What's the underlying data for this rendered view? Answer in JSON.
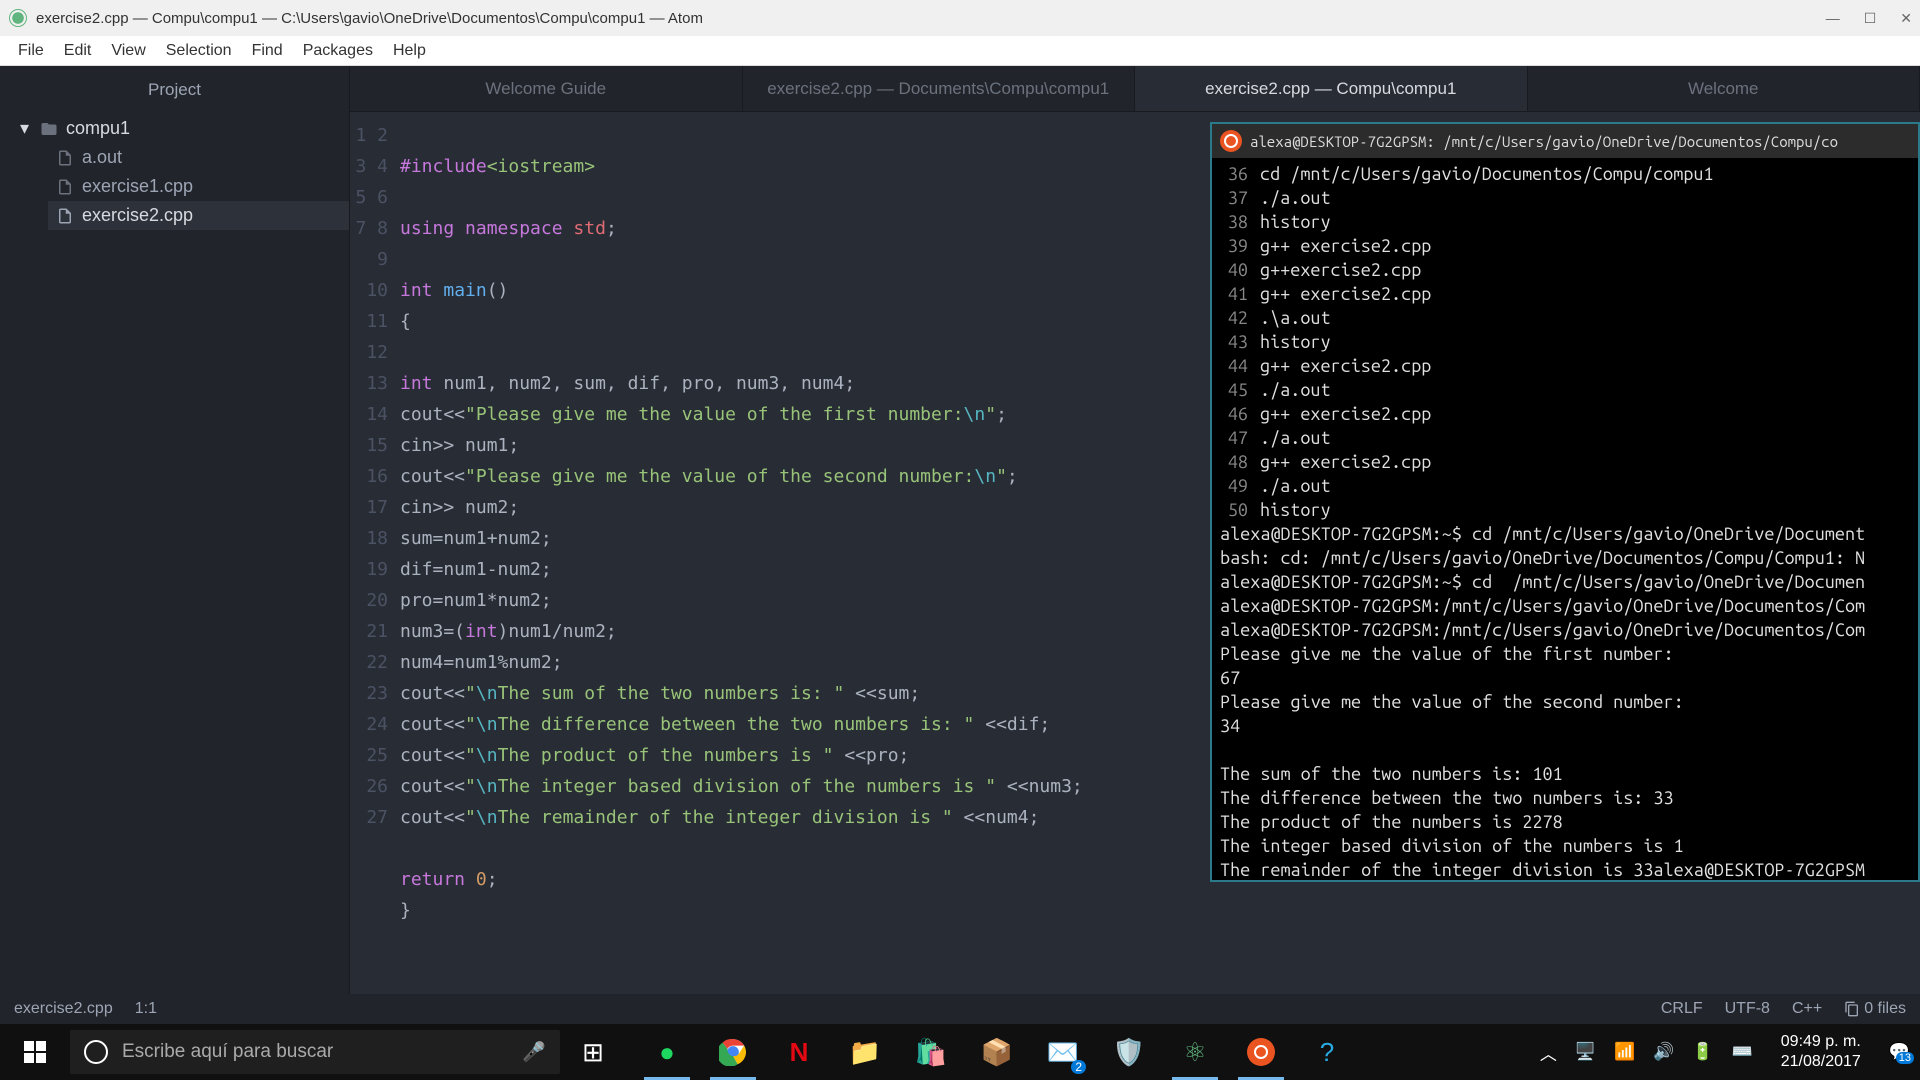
{
  "window": {
    "title": "exercise2.cpp — Compu\\compu1 — C:\\Users\\gavio\\OneDrive\\Documentos\\Compu\\compu1 — Atom"
  },
  "menu": [
    "File",
    "Edit",
    "View",
    "Selection",
    "Find",
    "Packages",
    "Help"
  ],
  "sidebar": {
    "header": "Project",
    "root": "compu1",
    "files": [
      "a.out",
      "exercise1.cpp",
      "exercise2.cpp"
    ]
  },
  "tabs": [
    {
      "label": "Welcome Guide",
      "active": false
    },
    {
      "label": "exercise2.cpp — Documents\\Compu\\compu1",
      "active": false
    },
    {
      "label": "exercise2.cpp — Compu\\compu1",
      "active": true
    },
    {
      "label": "Welcome",
      "active": false
    }
  ],
  "code": {
    "line_count": 27,
    "lines": [
      "",
      "#include<iostream>",
      "",
      "using namespace std;",
      "",
      "int main()",
      "{",
      "",
      "int num1, num2, sum, dif, pro, num3, num4;",
      "cout<<\"Please give me the value of the first number:\\n\";",
      "cin>> num1;",
      "cout<<\"Please give me the value of the second number:\\n\";",
      "cin>> num2;",
      "sum=num1+num2;",
      "dif=num1-num2;",
      "pro=num1*num2;",
      "num3=(int)num1/num2;",
      "num4=num1%num2;",
      "cout<<\"\\nThe sum of the two numbers is: \" <<sum;",
      "cout<<\"\\nThe difference between the two numbers is: \" <<dif;",
      "cout<<\"\\nThe product of the numbers is \" <<pro;",
      "cout<<\"\\nThe integer based division of the numbers is \" <<num3;",
      "cout<<\"\\nThe remainder of the integer division is \" <<num4;",
      "",
      "return 0;",
      "}",
      ""
    ]
  },
  "terminal": {
    "title": "alexa@DESKTOP-7G2GPSM: /mnt/c/Users/gavio/OneDrive/Documentos/Compu/co",
    "history": [
      {
        "n": "36",
        "cmd": "cd /mnt/c/Users/gavio/Documentos/Compu/compu1"
      },
      {
        "n": "37",
        "cmd": "./a.out"
      },
      {
        "n": "38",
        "cmd": "history"
      },
      {
        "n": "39",
        "cmd": "g++ exercise2.cpp"
      },
      {
        "n": "40",
        "cmd": "g++exercise2.cpp"
      },
      {
        "n": "41",
        "cmd": "g++ exercise2.cpp"
      },
      {
        "n": "42",
        "cmd": ".\\a.out"
      },
      {
        "n": "43",
        "cmd": "history"
      },
      {
        "n": "44",
        "cmd": "g++ exercise2.cpp"
      },
      {
        "n": "45",
        "cmd": "./a.out"
      },
      {
        "n": "46",
        "cmd": "g++ exercise2.cpp"
      },
      {
        "n": "47",
        "cmd": "./a.out"
      },
      {
        "n": "48",
        "cmd": "g++ exercise2.cpp"
      },
      {
        "n": "49",
        "cmd": "./a.out"
      },
      {
        "n": "50",
        "cmd": "history"
      }
    ],
    "output": [
      "alexa@DESKTOP-7G2GPSM:~$ cd /mnt/c/Users/gavio/OneDrive/Document",
      "bash: cd: /mnt/c/Users/gavio/OneDrive/Documentos/Compu/Compu1: N",
      "alexa@DESKTOP-7G2GPSM:~$ cd  /mnt/c/Users/gavio/OneDrive/Documen",
      "alexa@DESKTOP-7G2GPSM:/mnt/c/Users/gavio/OneDrive/Documentos/Com",
      "alexa@DESKTOP-7G2GPSM:/mnt/c/Users/gavio/OneDrive/Documentos/Com",
      "Please give me the value of the first number:",
      "67",
      "Please give me the value of the second number:",
      "34",
      "",
      "The sum of the two numbers is: 101",
      "The difference between the two numbers is: 33",
      "The product of the numbers is 2278",
      "The integer based division of the numbers is 1",
      "The remainder of the integer division is 33alexa@DESKTOP-7G2GPSM"
    ]
  },
  "status": {
    "file": "exercise2.cpp",
    "position": "1:1",
    "eol": "CRLF",
    "encoding": "UTF-8",
    "lang": "C++",
    "files": "0 files"
  },
  "taskbar": {
    "search_placeholder": "Escribe aquí para buscar",
    "time": "09:49 p. m.",
    "date": "21/08/2017",
    "mail_badge": "2",
    "notif_badge": "13"
  }
}
